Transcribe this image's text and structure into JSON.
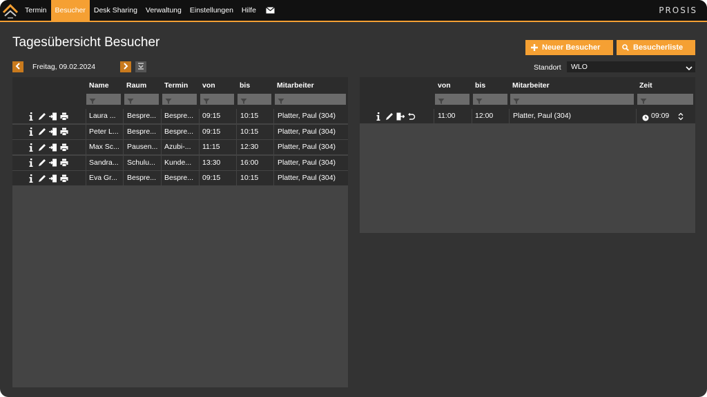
{
  "nav": {
    "items": [
      {
        "label": "Termin"
      },
      {
        "label": "Besucher"
      },
      {
        "label": "Desk Sharing"
      },
      {
        "label": "Verwaltung"
      },
      {
        "label": "Einstellungen"
      },
      {
        "label": "Hilfe"
      }
    ],
    "active": "Besucher",
    "brand": "PROSIS"
  },
  "page": {
    "title": "Tagesübersicht Besucher",
    "new_visitor_label": "Neuer Besucher",
    "visitor_list_label": "Besucherliste",
    "date": "Freitag, 09.02.2024",
    "standort_label": "Standort",
    "standort_value": "WLO"
  },
  "left_table": {
    "columns": [
      "Name",
      "Raum",
      "Termin",
      "von",
      "bis",
      "Mitarbeiter"
    ],
    "rows": [
      {
        "name": "Laura ...",
        "raum": "Bespre...",
        "termin": "Bespre...",
        "von": "09:15",
        "bis": "10:15",
        "mitarbeiter": "Platter, Paul (304)"
      },
      {
        "name": "Peter L...",
        "raum": "Bespre...",
        "termin": "Bespre...",
        "von": "09:15",
        "bis": "10:15",
        "mitarbeiter": "Platter, Paul (304)"
      },
      {
        "name": "Max Sc...",
        "raum": "Pausen...",
        "termin": "Azubi-...",
        "von": "11:15",
        "bis": "12:30",
        "mitarbeiter": "Platter, Paul (304)"
      },
      {
        "name": "Sandra...",
        "raum": "Schulu...",
        "termin": "Kunde...",
        "von": "13:30",
        "bis": "16:00",
        "mitarbeiter": "Platter, Paul (304)"
      },
      {
        "name": "Eva Gr...",
        "raum": "Bespre...",
        "termin": "Bespre...",
        "von": "09:15",
        "bis": "10:15",
        "mitarbeiter": "Platter, Paul (304)"
      }
    ]
  },
  "right_table": {
    "columns": [
      "von",
      "bis",
      "Mitarbeiter",
      "Zeit"
    ],
    "rows": [
      {
        "von": "11:00",
        "bis": "12:00",
        "mitarbeiter": "Platter, Paul (304)",
        "zeit": "09:09"
      }
    ]
  },
  "colors": {
    "accent": "#f5a033",
    "background": "#333333",
    "topbar": "#111111",
    "panel": "#444444",
    "row": "#2c2c2c"
  },
  "icons": [
    "info-icon",
    "edit-icon",
    "checkin-icon",
    "print-icon",
    "checkout-icon",
    "undo-icon",
    "clock-icon",
    "filter-icon",
    "mail-icon",
    "plus-icon",
    "search-icon",
    "chevron-left-icon",
    "chevron-right-icon",
    "calendar-icon",
    "chevron-down-icon"
  ]
}
